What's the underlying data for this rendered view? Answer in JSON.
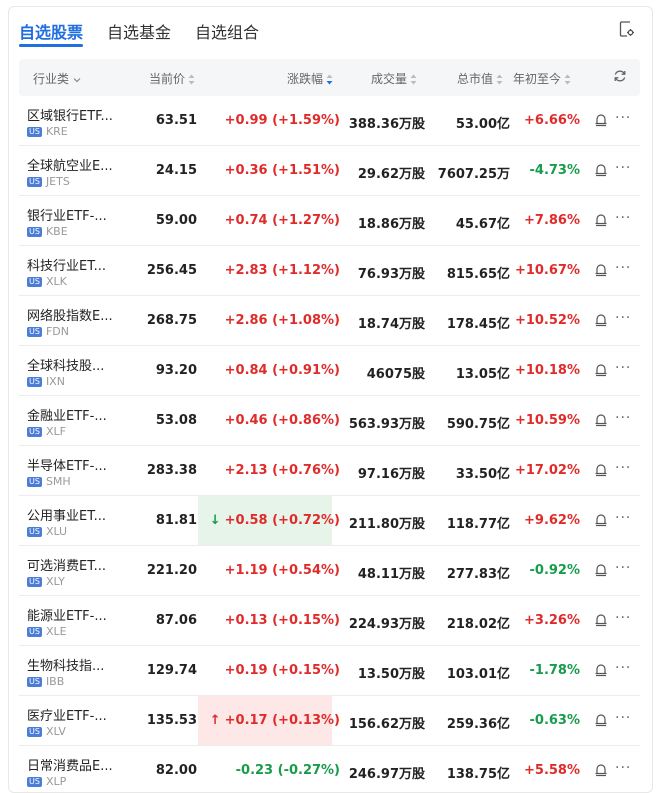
{
  "tabs": [
    {
      "label": "自选股票",
      "active": true
    },
    {
      "label": "自选基金",
      "active": false
    },
    {
      "label": "自选组合",
      "active": false
    }
  ],
  "header": {
    "industry": "行业类",
    "price": "当前价",
    "change": "涨跌幅",
    "volume": "成交量",
    "market_cap": "总市值",
    "ytd": "年初至今"
  },
  "colors": {
    "accent": "#1f6fe0",
    "up": "#e02b2b",
    "down": "#169c4a",
    "flash_up": "#fde7e7",
    "flash_down": "#e6f4ea"
  },
  "rows": [
    {
      "name": "区域银行ETF...",
      "market": "US",
      "code": "KRE",
      "price": "63.51",
      "change": "+0.99 (+1.59%)",
      "volume": "388.36万股",
      "market_cap": "53.00亿",
      "ytd": "+6.66%",
      "change_dir": "up",
      "ytd_dir": "up",
      "flash": ""
    },
    {
      "name": "全球航空业E...",
      "market": "US",
      "code": "JETS",
      "price": "24.15",
      "change": "+0.36 (+1.51%)",
      "volume": "29.62万股",
      "market_cap": "7607.25万",
      "ytd": "-4.73%",
      "change_dir": "up",
      "ytd_dir": "down",
      "flash": ""
    },
    {
      "name": "银行业ETF-...",
      "market": "US",
      "code": "KBE",
      "price": "59.00",
      "change": "+0.74 (+1.27%)",
      "volume": "18.86万股",
      "market_cap": "45.67亿",
      "ytd": "+7.86%",
      "change_dir": "up",
      "ytd_dir": "up",
      "flash": ""
    },
    {
      "name": "科技行业ET...",
      "market": "US",
      "code": "XLK",
      "price": "256.45",
      "change": "+2.83 (+1.12%)",
      "volume": "76.93万股",
      "market_cap": "815.65亿",
      "ytd": "+10.67%",
      "change_dir": "up",
      "ytd_dir": "up",
      "flash": ""
    },
    {
      "name": "网络股指数E...",
      "market": "US",
      "code": "FDN",
      "price": "268.75",
      "change": "+2.86 (+1.08%)",
      "volume": "18.74万股",
      "market_cap": "178.45亿",
      "ytd": "+10.52%",
      "change_dir": "up",
      "ytd_dir": "up",
      "flash": ""
    },
    {
      "name": "全球科技股...",
      "market": "US",
      "code": "IXN",
      "price": "93.20",
      "change": "+0.84 (+0.91%)",
      "volume": "46075股",
      "market_cap": "13.05亿",
      "ytd": "+10.18%",
      "change_dir": "up",
      "ytd_dir": "up",
      "flash": ""
    },
    {
      "name": "金融业ETF-...",
      "market": "US",
      "code": "XLF",
      "price": "53.08",
      "change": "+0.46 (+0.86%)",
      "volume": "563.93万股",
      "market_cap": "590.75亿",
      "ytd": "+10.59%",
      "change_dir": "up",
      "ytd_dir": "up",
      "flash": ""
    },
    {
      "name": "半导体ETF-...",
      "market": "US",
      "code": "SMH",
      "price": "283.38",
      "change": "+2.13 (+0.76%)",
      "volume": "97.16万股",
      "market_cap": "33.50亿",
      "ytd": "+17.02%",
      "change_dir": "up",
      "ytd_dir": "up",
      "flash": ""
    },
    {
      "name": "公用事业ET...",
      "market": "US",
      "code": "XLU",
      "price": "81.81",
      "change": "+0.58 (+0.72%)",
      "volume": "211.80万股",
      "market_cap": "118.77亿",
      "ytd": "+9.62%",
      "change_dir": "up",
      "ytd_dir": "up",
      "flash": "down"
    },
    {
      "name": "可选消费ET...",
      "market": "US",
      "code": "XLY",
      "price": "221.20",
      "change": "+1.19 (+0.54%)",
      "volume": "48.11万股",
      "market_cap": "277.83亿",
      "ytd": "-0.92%",
      "change_dir": "up",
      "ytd_dir": "down",
      "flash": ""
    },
    {
      "name": "能源业ETF-...",
      "market": "US",
      "code": "XLE",
      "price": "87.06",
      "change": "+0.13 (+0.15%)",
      "volume": "224.93万股",
      "market_cap": "218.02亿",
      "ytd": "+3.26%",
      "change_dir": "up",
      "ytd_dir": "up",
      "flash": ""
    },
    {
      "name": "生物科技指...",
      "market": "US",
      "code": "IBB",
      "price": "129.74",
      "change": "+0.19 (+0.15%)",
      "volume": "13.50万股",
      "market_cap": "103.01亿",
      "ytd": "-1.78%",
      "change_dir": "up",
      "ytd_dir": "down",
      "flash": ""
    },
    {
      "name": "医疗业ETF-...",
      "market": "US",
      "code": "XLV",
      "price": "135.53",
      "change": "+0.17 (+0.13%)",
      "volume": "156.62万股",
      "market_cap": "259.36亿",
      "ytd": "-0.63%",
      "change_dir": "up",
      "ytd_dir": "down",
      "flash": "up"
    },
    {
      "name": "日常消费品E...",
      "market": "US",
      "code": "XLP",
      "price": "82.00",
      "change": "-0.23 (-0.27%)",
      "volume": "246.97万股",
      "market_cap": "138.75亿",
      "ytd": "+5.58%",
      "change_dir": "down",
      "ytd_dir": "up",
      "flash": ""
    }
  ]
}
